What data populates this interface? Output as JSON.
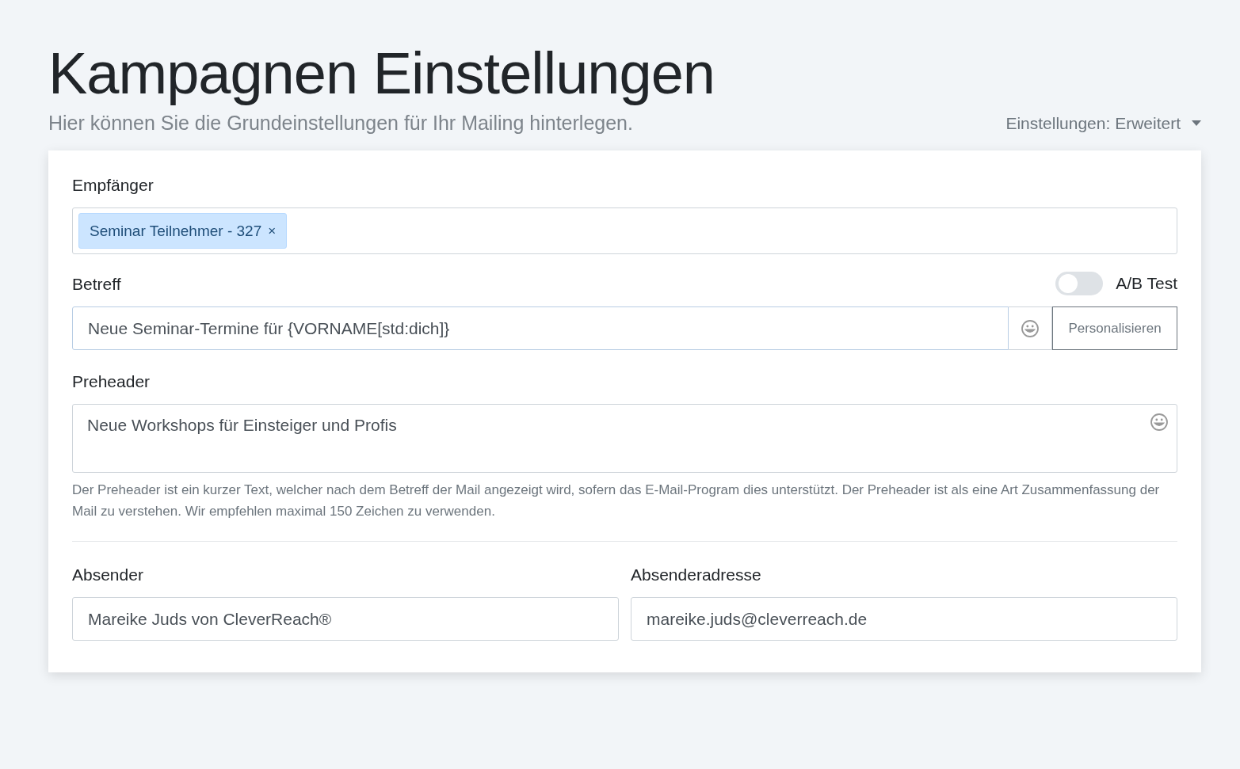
{
  "page": {
    "title": "Kampagnen Einstellungen",
    "subtitle": "Hier können Sie die Grundeinstellungen für Ihr Mailing hinterlegen.",
    "settings_dropdown": "Einstellungen: Erweitert"
  },
  "recipients": {
    "label": "Empfänger",
    "tags": [
      {
        "label": "Seminar Teilnehmer - 327",
        "remove": "×"
      }
    ]
  },
  "subject": {
    "label": "Betreff",
    "ab_test": {
      "label": "A/B Test",
      "on": false
    },
    "value": "Neue Seminar-Termine für {VORNAME[std:dich]}",
    "personalize_button": "Personalisieren"
  },
  "preheader": {
    "label": "Preheader",
    "value": "Neue Workshops für Einsteiger und Profis",
    "help": "Der Preheader ist ein kurzer Text, welcher nach dem Betreff der Mail angezeigt wird, sofern das E-Mail-Program dies unterstützt. Der Preheader ist als eine Art Zusammenfassung der Mail zu verstehen. Wir empfehlen maximal 150 Zeichen zu verwenden."
  },
  "sender": {
    "name_label": "Absender",
    "name_value": "Mareike Juds von CleverReach®",
    "address_label": "Absenderadresse",
    "address_value": "mareike.juds@cleverreach.de"
  }
}
